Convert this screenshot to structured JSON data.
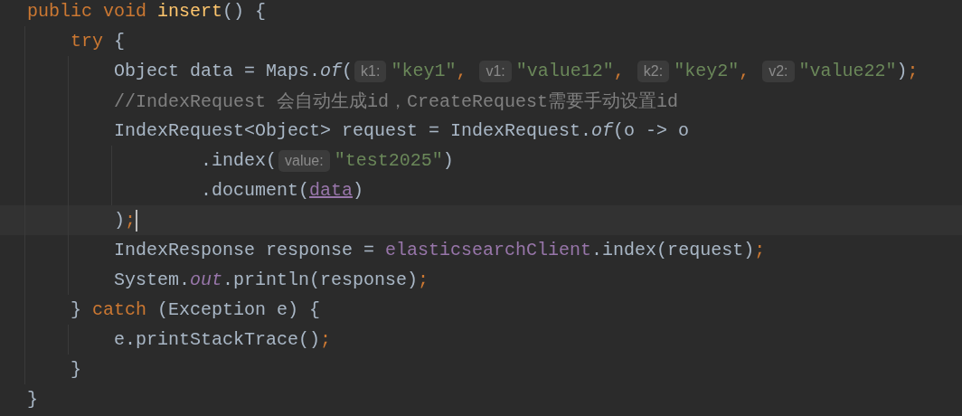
{
  "lines": [
    {
      "kind": "top",
      "current": false,
      "tokens": [
        {
          "kind": "keyword",
          "text": "public void "
        },
        {
          "kind": "method",
          "text": "insert"
        },
        {
          "kind": "plain",
          "text": "() {"
        }
      ]
    },
    {
      "kind": "block",
      "current": false,
      "tokens": [
        {
          "kind": "keyword",
          "text": "try "
        },
        {
          "kind": "plain",
          "text": "{"
        }
      ]
    },
    {
      "kind": "statement",
      "current": false,
      "tokens": [
        {
          "kind": "plain",
          "text": "Object data = Maps."
        },
        {
          "kind": "static",
          "text": "of"
        },
        {
          "kind": "plain",
          "text": "("
        },
        {
          "kind": "hint",
          "text": "k1:"
        },
        {
          "kind": "string",
          "text": "\"key1\""
        },
        {
          "kind": "punct",
          "text": ", "
        },
        {
          "kind": "hint",
          "text": "v1:"
        },
        {
          "kind": "string",
          "text": "\"value12\""
        },
        {
          "kind": "punct",
          "text": ", "
        },
        {
          "kind": "hint",
          "text": "k2:"
        },
        {
          "kind": "string",
          "text": "\"key2\""
        },
        {
          "kind": "punct",
          "text": ", "
        },
        {
          "kind": "hint",
          "text": "v2:"
        },
        {
          "kind": "string",
          "text": "\"value22\""
        },
        {
          "kind": "plain",
          "text": ")"
        },
        {
          "kind": "punct",
          "text": ";"
        }
      ]
    },
    {
      "kind": "statement",
      "current": false,
      "tokens": [
        {
          "kind": "comment",
          "text": "//IndexRequest 会自动生成id，CreateRequest需要手动设置id"
        }
      ]
    },
    {
      "kind": "statement",
      "current": false,
      "tokens": [
        {
          "kind": "plain",
          "text": "IndexRequest<Object> request = IndexRequest."
        },
        {
          "kind": "static",
          "text": "of"
        },
        {
          "kind": "plain",
          "text": "(o -> o"
        }
      ]
    },
    {
      "kind": "continuation",
      "current": false,
      "tokens": [
        {
          "kind": "plain",
          "text": ".index("
        },
        {
          "kind": "hint",
          "text": "value:"
        },
        {
          "kind": "string",
          "text": "\"test2025\""
        },
        {
          "kind": "plain",
          "text": ")"
        }
      ]
    },
    {
      "kind": "continuation",
      "current": false,
      "tokens": [
        {
          "kind": "plain",
          "text": ".document("
        },
        {
          "kind": "reference",
          "text": "data"
        },
        {
          "kind": "plain",
          "text": ")"
        }
      ]
    },
    {
      "kind": "statement",
      "current": true,
      "tokens": [
        {
          "kind": "plain",
          "text": ")"
        },
        {
          "kind": "punct",
          "text": ";"
        }
      ]
    },
    {
      "kind": "statement",
      "current": false,
      "tokens": [
        {
          "kind": "plain",
          "text": "IndexResponse response = "
        },
        {
          "kind": "field",
          "text": "elasticsearchClient"
        },
        {
          "kind": "plain",
          "text": ".index(request)"
        },
        {
          "kind": "punct",
          "text": ";"
        }
      ]
    },
    {
      "kind": "statement",
      "current": false,
      "tokens": [
        {
          "kind": "plain",
          "text": "System."
        },
        {
          "kind": "static-field",
          "text": "out"
        },
        {
          "kind": "plain",
          "text": ".println(response)"
        },
        {
          "kind": "punct",
          "text": ";"
        }
      ]
    },
    {
      "kind": "block",
      "current": false,
      "tokens": [
        {
          "kind": "plain",
          "text": "} "
        },
        {
          "kind": "keyword",
          "text": "catch "
        },
        {
          "kind": "plain",
          "text": "(Exception e) {"
        }
      ]
    },
    {
      "kind": "statement",
      "current": false,
      "tokens": [
        {
          "kind": "plain",
          "text": "e.printStackTrace()"
        },
        {
          "kind": "punct",
          "text": ";"
        }
      ]
    },
    {
      "kind": "block",
      "current": false,
      "tokens": [
        {
          "kind": "plain",
          "text": "}"
        }
      ]
    },
    {
      "kind": "top",
      "current": false,
      "tokens": [
        {
          "kind": "plain",
          "text": "}"
        }
      ]
    }
  ]
}
